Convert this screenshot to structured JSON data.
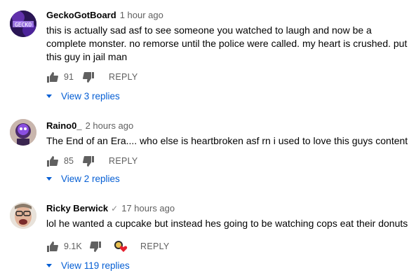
{
  "comments": [
    {
      "author": "GeckoGotBoard",
      "time": "1 hour ago",
      "text": "this is actually sad asf to see someone you watched to laugh and now be a complete monster. no remorse until the police were called. my heart is crushed. put this guy in jail man",
      "likes": "91",
      "reply_label": "REPLY",
      "view_replies": "View 3 replies"
    },
    {
      "author": "Raino0_",
      "time": "2 hours ago",
      "text": "The End of an Era.... who else is heartbroken asf rn i used to love this guys content",
      "likes": "85",
      "reply_label": "REPLY",
      "view_replies": "View 2 replies"
    },
    {
      "author": "Ricky Berwick",
      "verified": "✓",
      "time": "17 hours ago",
      "text": "lol he wanted a cupcake but instead hes going to be watching cops eat their donuts",
      "likes": "9.1K",
      "reply_label": "REPLY",
      "view_replies": "View 119 replies"
    }
  ],
  "colors": {
    "link": "#065fd4",
    "meta": "#606060",
    "heart": "#e5202e"
  },
  "icons": [
    "thumbs-up-icon",
    "thumbs-down-icon",
    "caret-down-icon",
    "creator-heart-icon",
    "verified-check-icon"
  ]
}
